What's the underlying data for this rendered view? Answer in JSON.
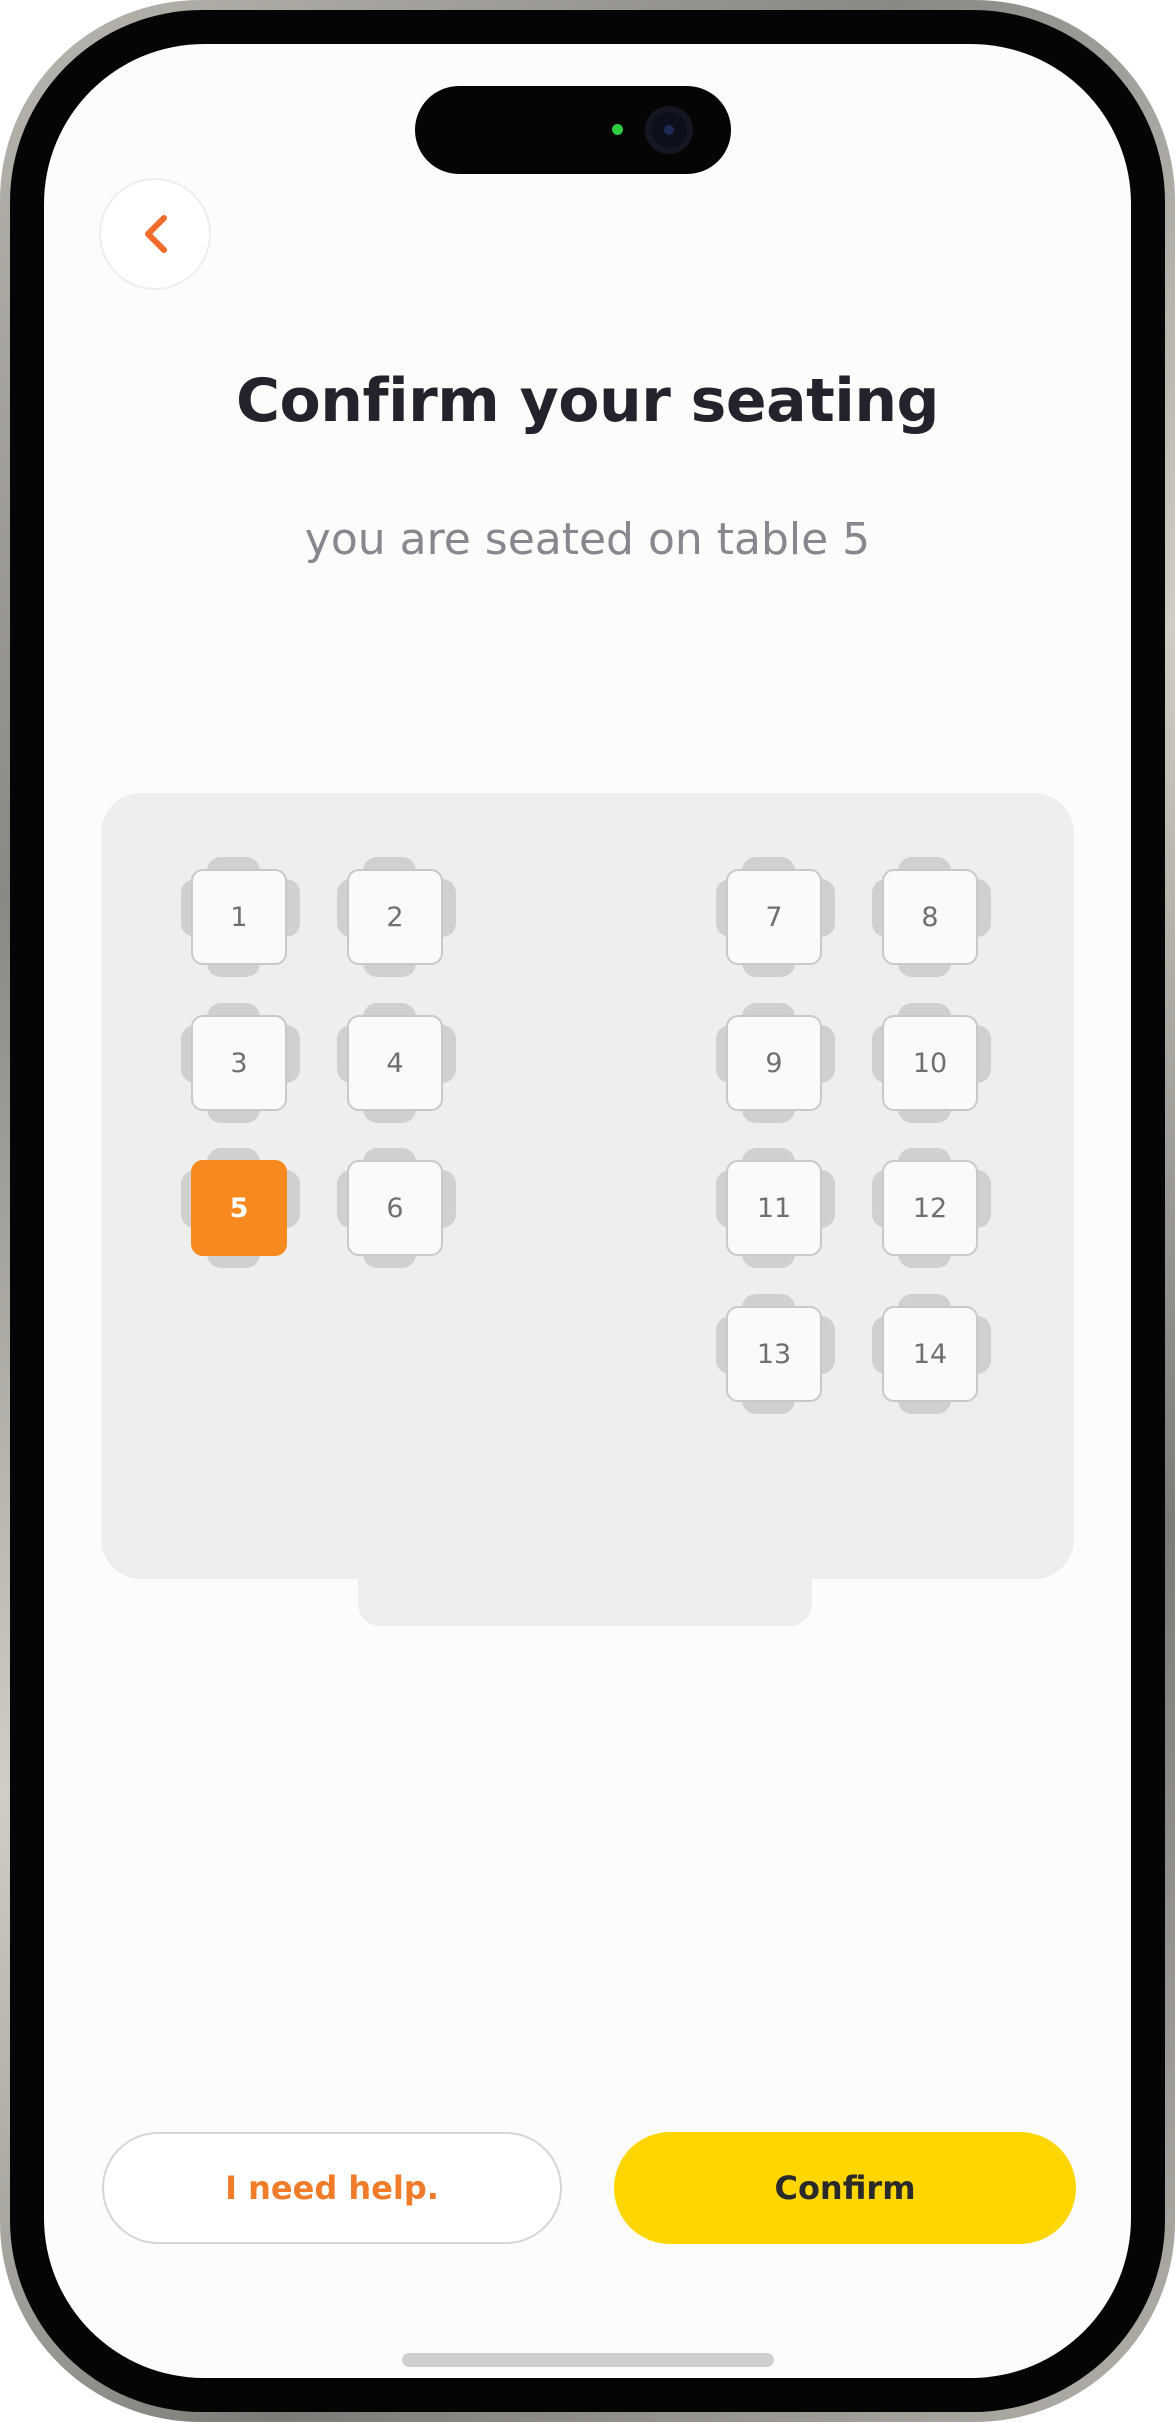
{
  "header": {
    "back_icon": "chevron-left-icon",
    "title": "Confirm your seating",
    "subtitle": "you are seated on table 5"
  },
  "floor_plan": {
    "selected_table": "5",
    "tables": [
      "1",
      "2",
      "3",
      "4",
      "5",
      "6",
      "7",
      "8",
      "9",
      "10",
      "11",
      "12",
      "13",
      "14"
    ]
  },
  "actions": {
    "help_label": "I need help.",
    "confirm_label": "Confirm"
  },
  "colors": {
    "accent_orange": "#f7891e",
    "confirm_yellow": "#ffd600",
    "help_text_orange": "#f07c2a"
  }
}
